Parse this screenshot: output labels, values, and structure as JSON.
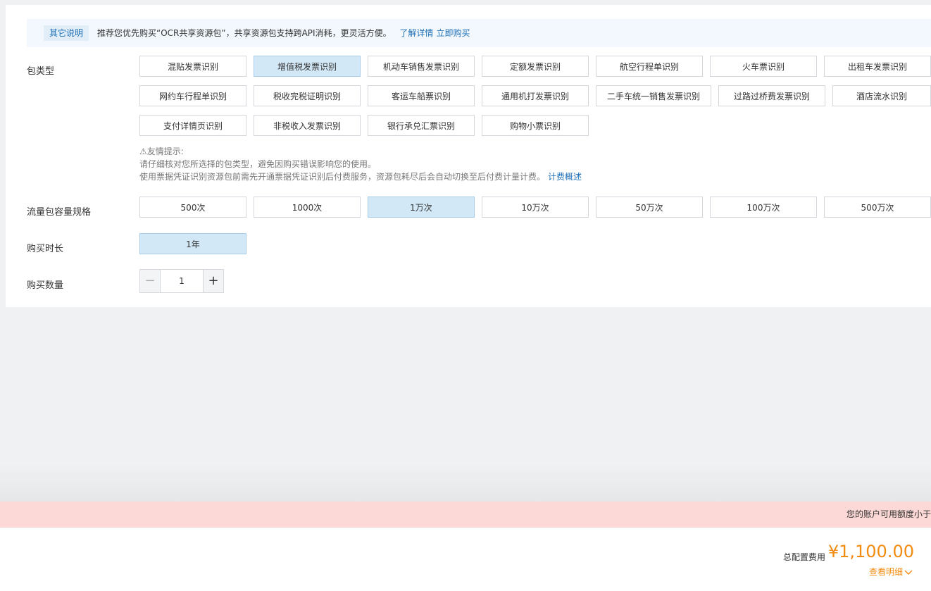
{
  "notice": {
    "tag": "其它说明",
    "text": "推荐您优先购买“OCR共享资源包”，共享资源包支持跨API消耗，更灵活方便。",
    "link1": "了解详情",
    "link2": "立即购买"
  },
  "package_type": {
    "label": "包类型",
    "options": [
      "混贴发票识别",
      "增值税发票识别",
      "机动车销售发票识别",
      "定额发票识别",
      "航空行程单识别",
      "火车票识别",
      "出租车发票识别",
      "网约车行程单识别",
      "税收完税证明识别",
      "客运车船票识别",
      "通用机打发票识别",
      "二手车统一销售发票识别",
      "过路过桥费发票识别",
      "酒店流水识别",
      "支付详情页识别",
      "非税收入发票识别",
      "银行承兑汇票识别",
      "购物小票识别"
    ],
    "selected": "增值税发票识别"
  },
  "tips": {
    "title": "⚠友情提示:",
    "line1": "请仔细核对您所选择的包类型，避免因购买错误影响您的使用。",
    "line2": "使用票据凭证识别资源包前需先开通票据凭证识别后付费服务，资源包耗尽后会自动切换至后付费计量计费。",
    "link": "计费概述"
  },
  "capacity": {
    "label": "流量包容量规格",
    "options": [
      "500次",
      "1000次",
      "1万次",
      "10万次",
      "50万次",
      "100万次",
      "500万次"
    ],
    "selected": "1万次"
  },
  "duration": {
    "label": "购买时长",
    "options": [
      "1年"
    ],
    "selected": "1年"
  },
  "quantity": {
    "label": "购买数量",
    "value": "1",
    "minus": "−",
    "plus": "+"
  },
  "alert": {
    "text": "您的账户可用额度小于"
  },
  "footer": {
    "total_label": "总配置费用",
    "total_price": "¥1,100.00",
    "detail_link": "查看明细"
  },
  "colors": {
    "accent": "#1f6fb5",
    "selected_bg": "#d3e8f7",
    "price": "#f28c10",
    "alert_bg": "#fcd9d6"
  }
}
